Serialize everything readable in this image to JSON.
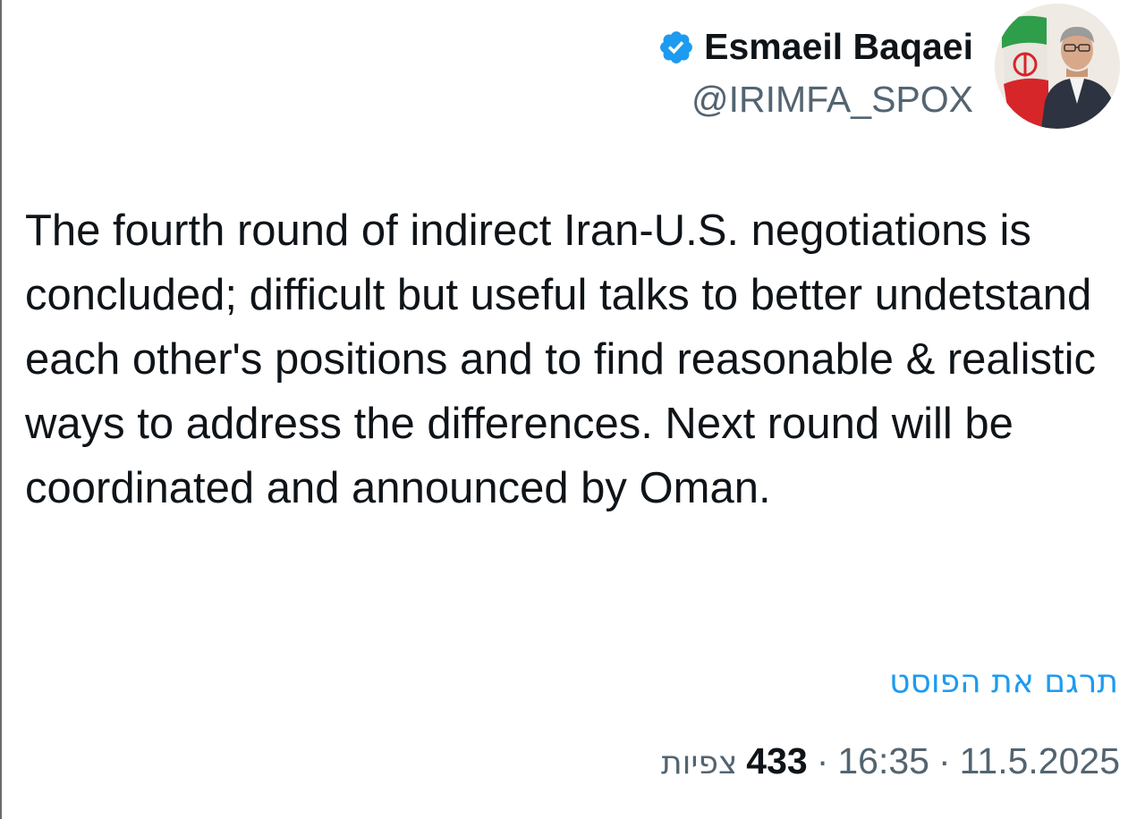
{
  "author": {
    "display_name": "Esmaeil Baqaei",
    "handle": "@IRIMFA_SPOX",
    "verified": true,
    "verified_icon": "verified-badge-icon",
    "avatar": "avatar-photo"
  },
  "tweet": {
    "text": "The fourth round of indirect Iran-U.S. negotiations is concluded; difficult but useful talks to better undetstand each other's positions and to find reasonable & realistic ways to address the differences. Next round will be coordinated and announced by Oman."
  },
  "translate_label": "תרגם את הפוסט",
  "meta": {
    "date": "11.5.2025",
    "time": "16:35",
    "views_count": "433",
    "views_label": "צפיות",
    "separator": "·"
  },
  "colors": {
    "link": "#1d9bf0",
    "verified": "#1d9bf0",
    "secondary_text": "#536471",
    "primary_text": "#0f1419"
  }
}
